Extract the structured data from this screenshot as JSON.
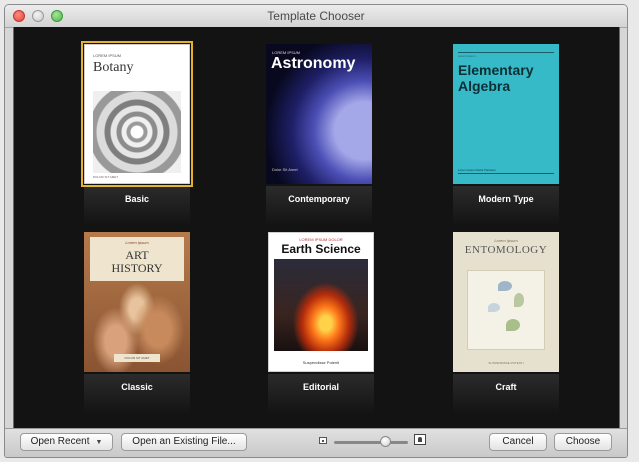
{
  "window": {
    "title": "Template Chooser"
  },
  "templates": [
    {
      "label": "Basic",
      "selected": true,
      "cover": {
        "small": "LOREM IPSUM",
        "title": "Botany",
        "foot": "DOLOR SIT AMET"
      }
    },
    {
      "label": "Contemporary",
      "selected": false,
      "cover": {
        "small": "LOREM IPSUM",
        "title": "Astronomy",
        "foot": "Dolor Sit Amet"
      }
    },
    {
      "label": "Modern Type",
      "selected": false,
      "cover": {
        "small": "Lorem Ipsum",
        "title1": "Elementary",
        "title2": "Algebra",
        "foot": "Lorem Ipsum Dolor Partners"
      }
    },
    {
      "label": "Classic",
      "selected": false,
      "cover": {
        "small": "Lorem Ipsum",
        "title1": "ART",
        "title2": "HISTORY",
        "foot": "DOLOR SIT AMET"
      }
    },
    {
      "label": "Editorial",
      "selected": false,
      "cover": {
        "small": "LOREM IPSUM DOLOR",
        "title": "Earth Science",
        "foot": "Suspendisse Potenti"
      }
    },
    {
      "label": "Craft",
      "selected": false,
      "cover": {
        "small": "Lorem Ipsum",
        "title": "ENTOMOLOGY",
        "foot": "SUSPENDISSE POTENTI"
      }
    }
  ],
  "toolbar": {
    "open_recent_label": "Open Recent",
    "open_existing_label": "Open an Existing File...",
    "cancel_label": "Cancel",
    "choose_label": "Choose",
    "zoom_level": 0.7
  },
  "colors": {
    "selection": "#e5b12a",
    "content_bg": "#131313"
  }
}
